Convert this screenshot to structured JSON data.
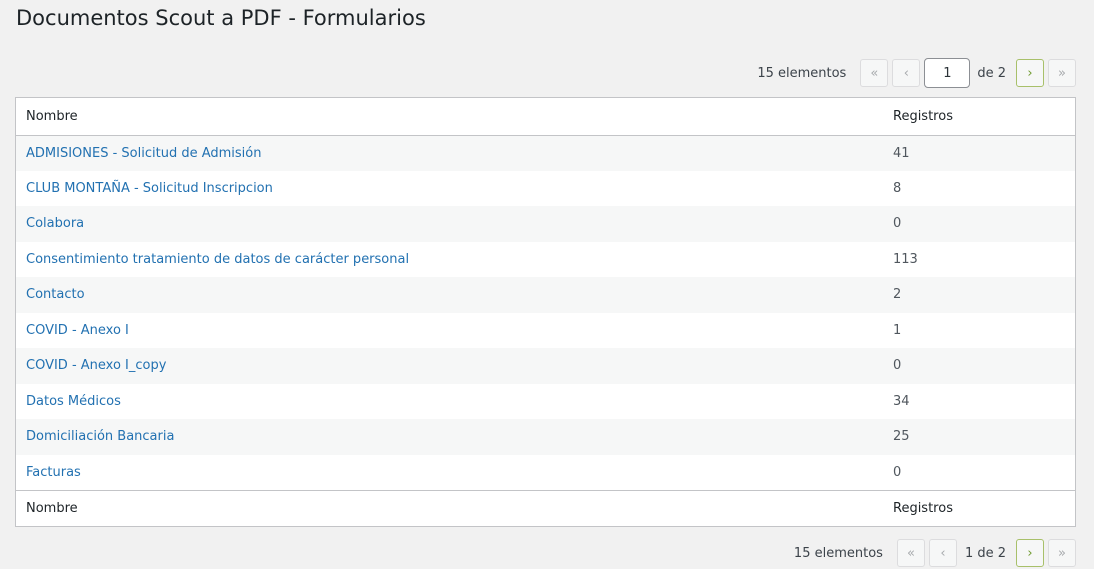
{
  "page": {
    "title": "Documentos Scout a PDF - Formularios"
  },
  "pagination": {
    "items_count": "15 elementos",
    "first_label": "«",
    "prev_label": "‹",
    "next_label": "›",
    "last_label": "»",
    "current_page": "1",
    "of_total": "de 2",
    "current_of_total": "1 de 2"
  },
  "table": {
    "columns": [
      "Nombre",
      "Registros"
    ],
    "rows": [
      {
        "name": "ADMISIONES - Solicitud de Admisión",
        "count": "41"
      },
      {
        "name": "CLUB MONTAÑA - Solicitud Inscripcion",
        "count": "8"
      },
      {
        "name": "Colabora",
        "count": "0"
      },
      {
        "name": "Consentimiento tratamiento de datos de carácter personal",
        "count": "113"
      },
      {
        "name": "Contacto",
        "count": "2"
      },
      {
        "name": "COVID - Anexo I",
        "count": "1"
      },
      {
        "name": "COVID - Anexo I_copy",
        "count": "0"
      },
      {
        "name": "Datos Médicos",
        "count": "34"
      },
      {
        "name": "Domiciliación Bancaria",
        "count": "25"
      },
      {
        "name": "Facturas",
        "count": "0"
      }
    ]
  },
  "colors": {
    "link": "#2271b1",
    "active_nav_border": "#a8c06a",
    "background": "#f1f1f1"
  }
}
